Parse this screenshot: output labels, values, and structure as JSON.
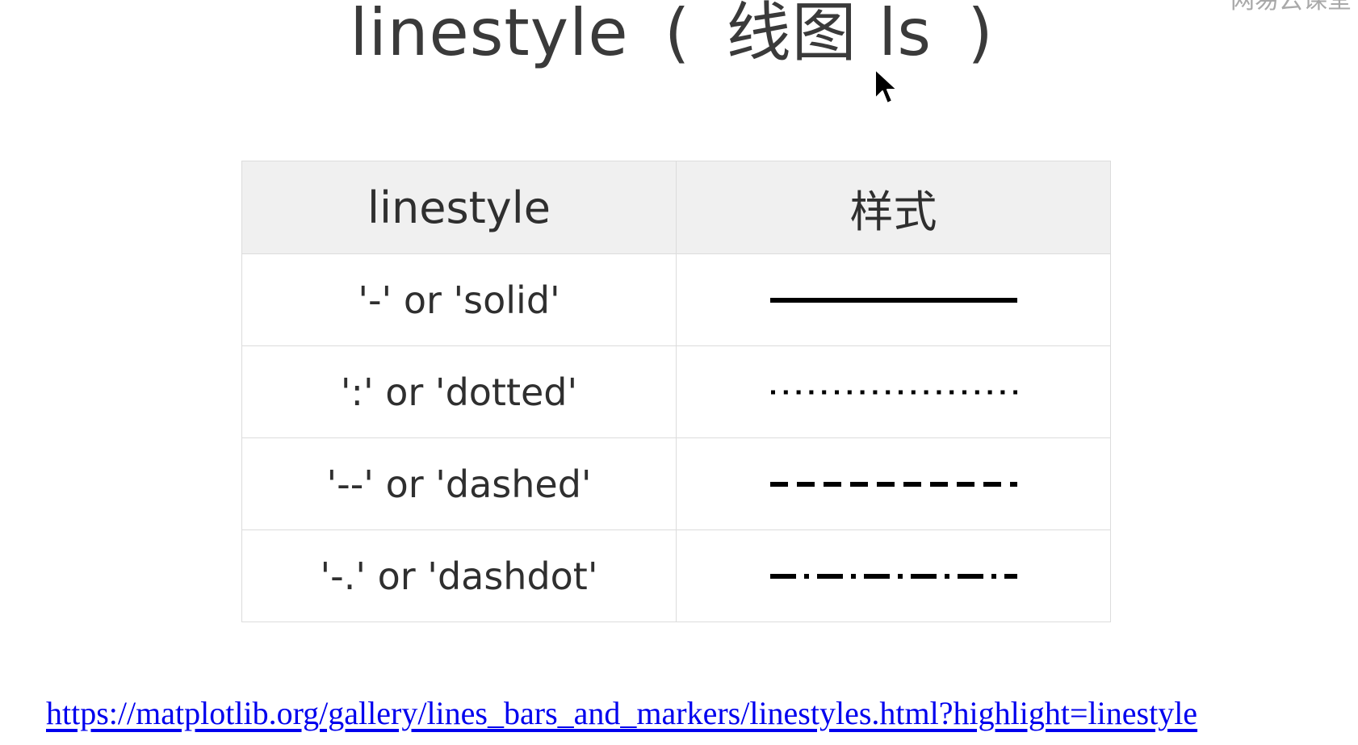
{
  "title": {
    "main": "linestyle",
    "open_paren": "(",
    "chinese": "线图",
    "abbr": "ls",
    "close_paren": ")"
  },
  "watermark": "网易云课堂",
  "table": {
    "headers": [
      "linestyle",
      "样式"
    ],
    "rows": [
      {
        "code": "'-' or 'solid'",
        "style": "solid"
      },
      {
        "code": "':' or 'dotted'",
        "style": "dotted"
      },
      {
        "code": "'--' or 'dashed'",
        "style": "dashed"
      },
      {
        "code": "'-.' or 'dashdot'",
        "style": "dashdot"
      }
    ]
  },
  "link": "https://matplotlib.org/gallery/lines_bars_and_markers/linestyles.html?highlight=linestyle",
  "colors": {
    "text": "#2f2f2f",
    "header_bg": "#f0f0f0",
    "border": "#dcdcdc",
    "link": "#0000ee",
    "line": "#000000"
  },
  "icons": [
    "mouse-pointer-icon"
  ]
}
